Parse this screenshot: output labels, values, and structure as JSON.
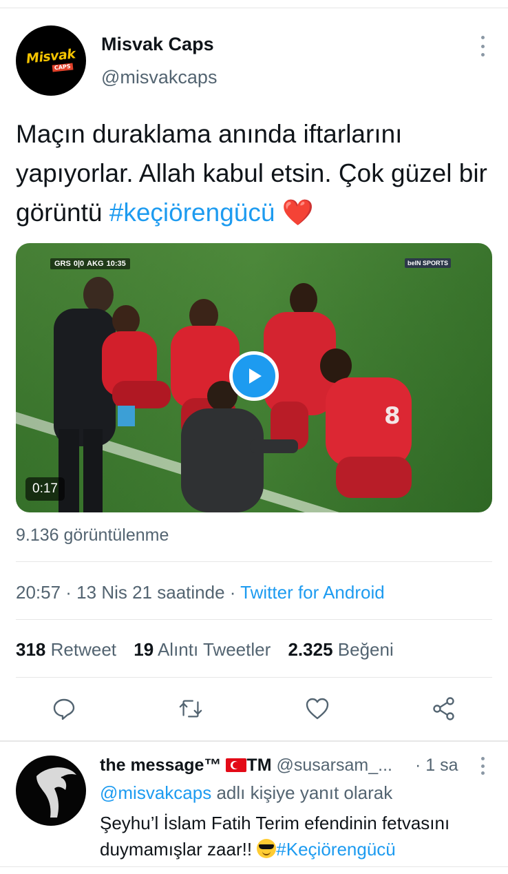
{
  "tweet": {
    "author": {
      "name": "Misvak Caps",
      "handle": "@misvakcaps",
      "avatar_logo": "Misvak",
      "avatar_logo_sub": "CAPS"
    },
    "text_parts": {
      "body": "Maçın duraklama anında iftarlarını yapıyorlar. Allah kabul etsin. Çok güzel bir görüntü ",
      "hashtag": "#keçiörengücü",
      "emoji": "❤️"
    },
    "video": {
      "duration": "0:17",
      "scorebug": {
        "home": "GRS",
        "score": "0|0",
        "away": "AKG",
        "clock": "10:35"
      },
      "broadcaster": "beIN SPORTS"
    },
    "views": "9.136 görüntülenme",
    "timestamp": {
      "time_date": "20:57 · 13 Nis 21 saatinde · ",
      "source": "Twitter for Android"
    },
    "stats": {
      "retweets": {
        "count": "318",
        "label": "Retweet"
      },
      "quotes": {
        "count": "19",
        "label": "Alıntı Tweetler"
      },
      "likes": {
        "count": "2.325",
        "label": "Beğeni"
      }
    },
    "actions": {
      "reply_icon": "comment-icon",
      "retweet_icon": "retweet-icon",
      "like_icon": "heart-icon",
      "share_icon": "share-icon"
    }
  },
  "reply": {
    "name": "the message™",
    "name_suffix": "TM",
    "handle": "@susarsam_...",
    "time": "· 1 sa",
    "reply_to_mention": "@misvakcaps",
    "reply_to_text": " adlı kişiye yanıt olarak",
    "text": "Şeyhu’l İslam Fatih Terim efendinin fetvasını duymamışlar zaar!! ",
    "hashtag": "#Keçiörengücü"
  },
  "colors": {
    "accent": "#1d9bf0",
    "text": "#0f1419",
    "muted": "#536471",
    "heart": "#e0245e"
  }
}
